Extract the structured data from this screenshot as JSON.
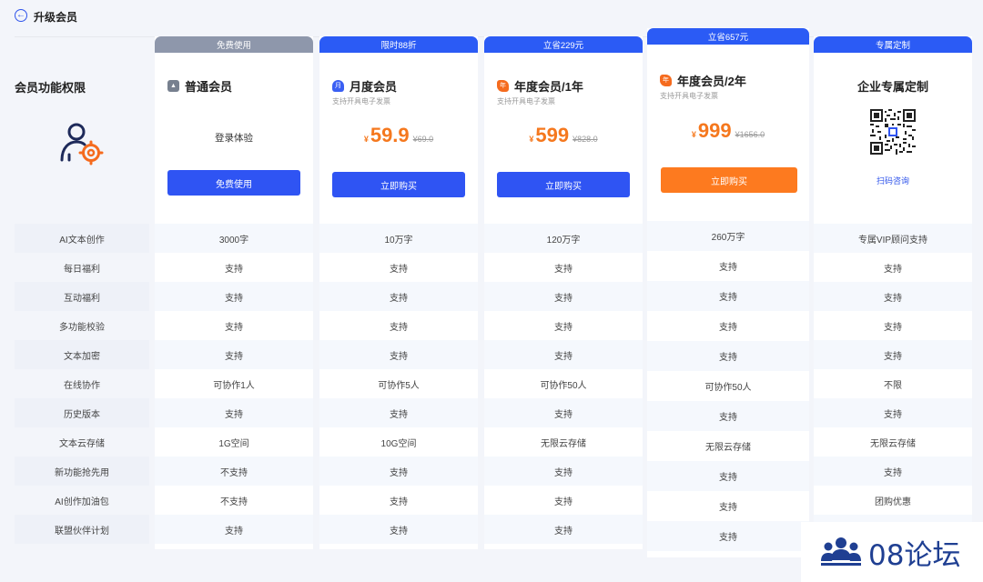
{
  "header": {
    "title": "升级会员",
    "back_icon": "back-arrow-circle-icon"
  },
  "left": {
    "title": "会员功能权限",
    "illustration_icon": "user-settings-icon",
    "features": [
      "AI文本创作",
      "每日福利",
      "互动福利",
      "多功能校验",
      "文本加密",
      "在线协作",
      "历史版本",
      "文本云存储",
      "新功能抢先用",
      "AI创作加油包",
      "联盟伙伴计划"
    ]
  },
  "plans": [
    {
      "banner": "免费使用",
      "name": "普通会员",
      "icon": "free-member-icon",
      "trial": "登录体验",
      "button": "免费使用",
      "cells": [
        "3000字",
        "支持",
        "支持",
        "支持",
        "支持",
        "可协作1人",
        "支持",
        "1G空间",
        "不支持",
        "不支持",
        "支持"
      ]
    },
    {
      "banner": "限时88折",
      "name": "月度会员",
      "icon": "monthly-member-icon",
      "icon_text": "月",
      "sub": "支持开具电子发票",
      "currency": "¥",
      "price": "59.9",
      "old_price": "¥69.0",
      "button": "立即购买",
      "cells": [
        "10万字",
        "支持",
        "支持",
        "支持",
        "支持",
        "可协作5人",
        "支持",
        "10G空间",
        "支持",
        "支持",
        "支持"
      ]
    },
    {
      "banner": "立省229元",
      "name": "年度会员/1年",
      "icon": "annual-member-icon",
      "icon_text": "年",
      "sub": "支持开具电子发票",
      "currency": "¥",
      "price": "599",
      "old_price": "¥828.0",
      "button": "立即购买",
      "cells": [
        "120万字",
        "支持",
        "支持",
        "支持",
        "支持",
        "可协作50人",
        "支持",
        "无限云存储",
        "支持",
        "支持",
        "支持"
      ]
    },
    {
      "banner": "立省657元",
      "name": "年度会员/2年",
      "icon": "two-year-member-icon",
      "icon_text": "年",
      "sub": "支持开具电子发票",
      "currency": "¥",
      "price": "999",
      "old_price": "¥1656.0",
      "button": "立即购买",
      "cells": [
        "260万字",
        "支持",
        "支持",
        "支持",
        "支持",
        "可协作50人",
        "支持",
        "无限云存储",
        "支持",
        "支持",
        "支持"
      ]
    },
    {
      "banner": "专属定制",
      "name": "企业专属定制",
      "qr_icon": "qr-code-icon",
      "scan_link": "扫码咨询",
      "cells": [
        "专属VIP顾问支持",
        "支持",
        "支持",
        "支持",
        "支持",
        "不限",
        "支持",
        "无限云存储",
        "支持",
        "团购优惠",
        ""
      ]
    }
  ],
  "watermark": {
    "text": "08论坛",
    "icon": "people-group-icon"
  },
  "colors": {
    "primary": "#2f54f3",
    "accent_orange": "#fd7a1f",
    "banner_gray": "#8e97ab",
    "background": "#f3f5fa"
  }
}
